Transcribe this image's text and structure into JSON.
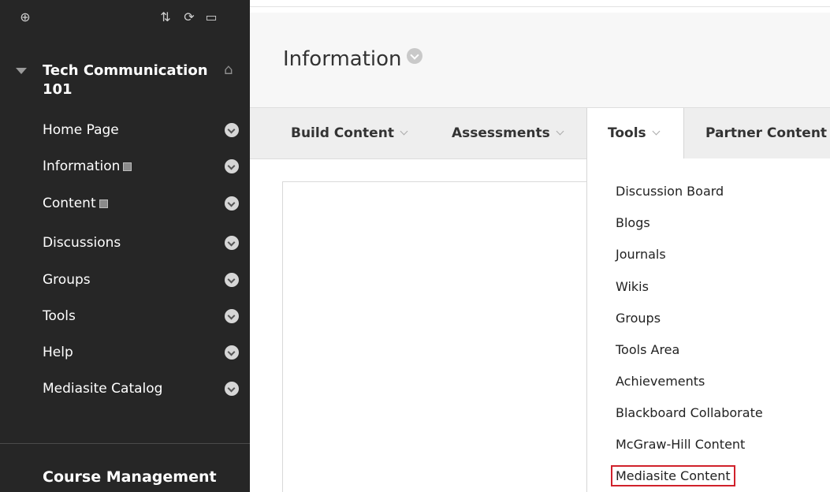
{
  "sidebar": {
    "course_title": "Tech Communication 101",
    "menu": [
      {
        "label": "Home Page",
        "has_chip": false
      },
      {
        "label": "Information",
        "has_chip": true
      },
      {
        "label": "Content",
        "has_chip": true
      },
      {
        "label": "Discussions",
        "has_chip": false
      },
      {
        "label": "Groups",
        "has_chip": false
      },
      {
        "label": "Tools",
        "has_chip": false
      },
      {
        "label": "Help",
        "has_chip": false
      },
      {
        "label": "Mediasite Catalog",
        "has_chip": false
      }
    ],
    "course_management_title": "Course Management",
    "icons": [
      "add-icon",
      "sort-icon",
      "refresh-icon",
      "folder-icon",
      "home-icon"
    ]
  },
  "main": {
    "page_title": "Information",
    "action_bar": [
      {
        "label": "Build Content"
      },
      {
        "label": "Assessments"
      },
      {
        "label": "Tools"
      },
      {
        "label": "Partner Content"
      }
    ],
    "tools_dropdown": [
      "Discussion Board",
      "Blogs",
      "Journals",
      "Wikis",
      "Groups",
      "Tools Area",
      "Achievements",
      "Blackboard Collaborate",
      "McGraw-Hill Content",
      "Mediasite Content"
    ],
    "highlighted_item": "Mediasite Content"
  },
  "colors": {
    "sidebar_bg": "#262626",
    "highlight": "#d0212b"
  }
}
